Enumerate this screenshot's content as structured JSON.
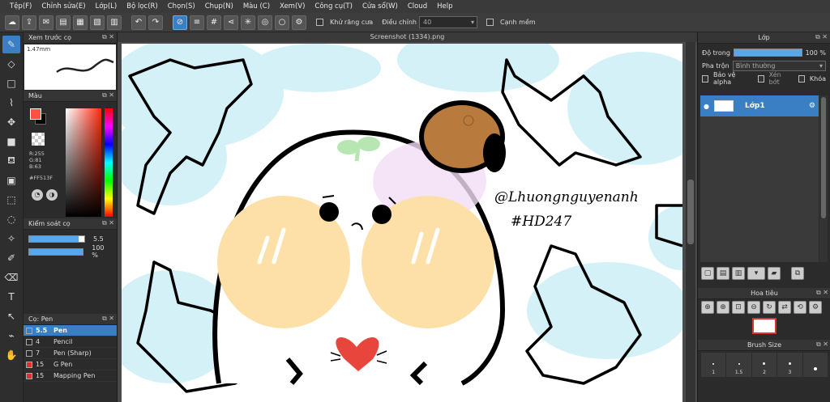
{
  "menu": [
    "Tệp(F)",
    "Chỉnh sửa(E)",
    "Lớp(L)",
    "Bộ lọc(R)",
    "Chọn(S)",
    "Chụp(N)",
    "Màu (C)",
    "Xem(V)",
    "Công cụ(T)",
    "Cửa sổ(W)",
    "Cloud",
    "Help"
  ],
  "toolbar": {
    "antialias_label": "Khử răng cưa",
    "adjust_label": "Điều chỉnh",
    "adjust_value": "40",
    "smooth_label": "Cạnh mềm"
  },
  "left_panels": {
    "preview_title": "Xem trước cọ",
    "preview_size": "1.47mm",
    "color_title": "Màu",
    "rgb": {
      "r": "R:255",
      "g": "G:81",
      "b": "B:63"
    },
    "hex": "#FF513F",
    "brush_control_title": "Kiểm soát cọ",
    "size_value": "5.5",
    "size_fraction": 0.9,
    "opacity_value": "100 %",
    "opacity_fraction": 1.0,
    "brush_title": "Cọ: Pen",
    "brushes": [
      {
        "size": "5.5",
        "name": "Pen",
        "color": "#3a7fc4",
        "selected": true
      },
      {
        "size": "4",
        "name": "Pencil",
        "color": "#2a2a2a",
        "selected": false
      },
      {
        "size": "7",
        "name": "Pen (Sharp)",
        "color": "#2a2a2a",
        "selected": false
      },
      {
        "size": "15",
        "name": "G Pen",
        "color": "#e03030",
        "selected": false
      },
      {
        "size": "15",
        "name": "Mapping Pen",
        "color": "#e03030",
        "selected": false
      }
    ]
  },
  "document_tab": "Screenshot (1334).png",
  "canvas_texts": {
    "handle": "@Lhuongnguyenanh",
    "tag": "#HD247"
  },
  "right_panels": {
    "layer_title": "Lớp",
    "opacity_label": "Độ trong",
    "opacity_value": "100 %",
    "blend_label": "Pha trộn",
    "blend_value": "Bình thường",
    "protect_alpha": "Bảo vệ alpha",
    "clipping": "Xén bớt",
    "lock": "Khóa",
    "layer_name": "Lớp1",
    "navigator_title": "Hoa tiêu",
    "brush_size_title": "Brush Size",
    "brush_sizes": [
      "1",
      "1.5",
      "2",
      "3",
      ""
    ]
  },
  "colors": {
    "accent": "#3a7fc4",
    "foreground": "#FF513F",
    "sky": "#d4f1f8",
    "cheek": "#fde0a8",
    "heart": "#e8453c",
    "hair": "#b87a3d"
  }
}
